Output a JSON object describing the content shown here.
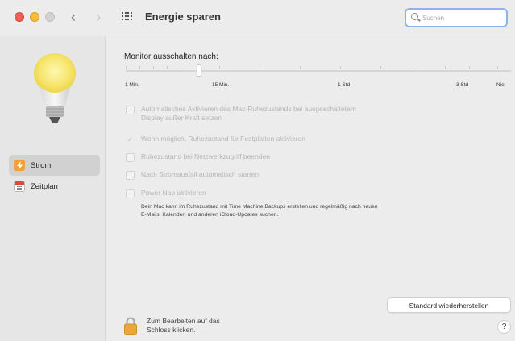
{
  "window": {
    "title": "Energie sparen"
  },
  "toolbar": {
    "back_glyph": "‹",
    "forward_glyph": "›",
    "grid_icon": "show-all-grid-icon"
  },
  "search": {
    "placeholder": "Suchen",
    "value": ""
  },
  "sidebar": {
    "items": [
      {
        "label": "Strom",
        "icon": "power-bolt-icon",
        "selected": true
      },
      {
        "label": "Zeitplan",
        "icon": "calendar-icon",
        "selected": false
      }
    ]
  },
  "main": {
    "monitor_label": "Monitor ausschalten nach:",
    "slider": {
      "tick_labels": [
        "1 Min.",
        "15 Min.",
        "1 Std",
        "3 Std",
        "Nie"
      ],
      "selected_value": "3 Min."
    },
    "options": [
      {
        "label": "Automatisches Aktivieren des Mac-Ruhezustands bei ausgeschaltetem",
        "label_line2": "Display außer Kraft setzen",
        "checked": false,
        "enabled": false
      },
      {
        "label": "Wenn möglich, Ruhezustand für Festplatten aktivieren",
        "checked": true,
        "enabled": false
      },
      {
        "label": "Ruhezustand bei Netzwerkzugriff beenden",
        "checked": false,
        "enabled": false
      },
      {
        "label": "Nach Stromausfall automatisch starten",
        "checked": false,
        "enabled": false
      },
      {
        "label": "Power Nap aktivieren",
        "checked": false,
        "enabled": false
      }
    ],
    "power_nap_description_line1": "Dein Mac kann im Ruhezustand mit Time Machine Backups erstellen und regelmäßig nach neuen",
    "power_nap_description_line2": "E-Mails, Kalender- und anderen iCloud-Updates suchen.",
    "restore_button": "Standard wiederherstellen",
    "lock_text_line1": "Zum Bearbeiten auf das",
    "lock_text_line2": "Schloss klicken.",
    "help_label": "?"
  },
  "colors": {
    "close": "#ee5f58",
    "minimize": "#f7bd3b",
    "zoom_disabled": "#d2d2d2",
    "search_focus": "#8fb3e6",
    "power_icon": "#f0a23a",
    "lock": "#e9a93a"
  }
}
